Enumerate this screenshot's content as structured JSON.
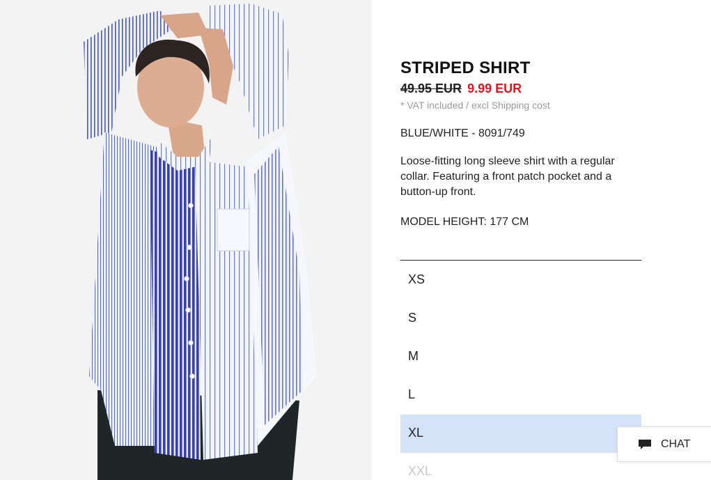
{
  "product": {
    "image_alt": "Model wearing striped shirt",
    "title": "STRIPED SHIRT",
    "old_price": "49.95 EUR",
    "new_price": "9.99 EUR",
    "vat_note": "* VAT included / excl Shipping cost",
    "color_code": "BLUE/WHITE - 8091/749",
    "description": "Loose-fitting long sleeve shirt with a regular collar. Featuring a front patch pocket and a button-up front.",
    "model_height": "MODEL HEIGHT: 177 CM"
  },
  "sizes": [
    {
      "label": "XS",
      "state": "available"
    },
    {
      "label": "S",
      "state": "available"
    },
    {
      "label": "M",
      "state": "available"
    },
    {
      "label": "L",
      "state": "available"
    },
    {
      "label": "XL",
      "state": "selected"
    },
    {
      "label": "XXL",
      "state": "unavailable"
    }
  ],
  "chat": {
    "label": "CHAT",
    "icon": "chat-bubble-icon"
  },
  "colors": {
    "sale_red": "#e3161f",
    "selected_size_bg": "#d4e3f8",
    "muted_text": "#9a9a9a"
  }
}
